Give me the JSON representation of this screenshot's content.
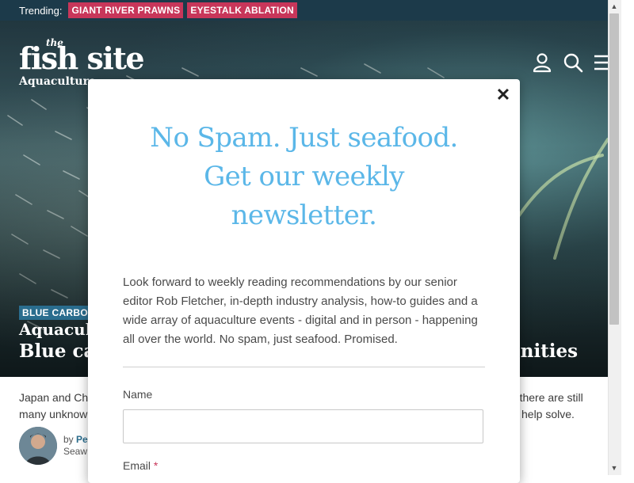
{
  "trending": {
    "label": "Trending:",
    "tags": [
      "GIANT RIVER PRAWNS",
      "EYESTALK ABLATION"
    ]
  },
  "logo": {
    "small": "the",
    "main": "fish site",
    "tagline": "Aquaculture"
  },
  "header_icons": [
    "user-icon",
    "search-icon",
    "menu-icon"
  ],
  "hero": {
    "category": "BLUE CARBON",
    "kicker": "Aquacult",
    "title_left": "Blue car",
    "title_right": "unities"
  },
  "summary": {
    "line1_left": "Japan and Chi",
    "line2_left": "many unknow",
    "line1_right": "ut there are still",
    "line2_right": "help solve."
  },
  "author": {
    "by": "by ",
    "name": "Pe",
    "org": "Seaw"
  },
  "modal": {
    "close": "✕",
    "title_line1": "No Spam. Just seafood.",
    "title_line2": "Get our weekly",
    "title_line3": "newsletter.",
    "body": "Look forward to weekly reading recommendations by our senior editor Rob Fletcher, in-depth industry analysis, how-to guides and a wide array of aquaculture events - digital and in person - happening all over the world. No spam, just seafood. Promised.",
    "name_label": "Name",
    "name_value": "",
    "email_label": "Email",
    "email_required": "*"
  },
  "colors": {
    "trending_bar": "#1c3a4a",
    "tag": "#c8365a",
    "modal_title": "#5bb7e8",
    "category_badge": "#2a6d8e"
  }
}
